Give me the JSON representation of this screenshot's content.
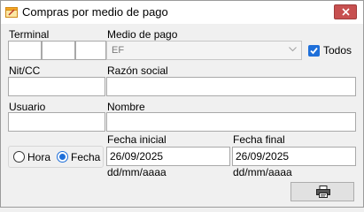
{
  "window": {
    "title": "Compras por medio de pago"
  },
  "labels": {
    "terminal": "Terminal",
    "medio_pago": "Medio de pago",
    "nit_cc": "Nit/CC",
    "razon_social": "Razón social",
    "usuario": "Usuario",
    "nombre": "Nombre",
    "fecha_inicial": "Fecha inicial",
    "fecha_final": "Fecha final",
    "date_format_inicial": "dd/mm/aaaa",
    "date_format_final": "dd/mm/aaaa"
  },
  "fields": {
    "terminal_1": "",
    "terminal_2": "",
    "terminal_3": "",
    "medio_pago_selected": "EF",
    "nit_cc": "",
    "razon_social": "",
    "usuario": "",
    "nombre": "",
    "fecha_inicial": "26/09/2025",
    "fecha_final": "26/09/2025"
  },
  "todos": {
    "label": "Todos",
    "checked": true
  },
  "time_mode": {
    "options": [
      "Hora",
      "Fecha"
    ],
    "selected": "Fecha"
  },
  "icons": {
    "app": "app-form-icon",
    "close": "close-icon",
    "print": "printer-icon"
  },
  "colors": {
    "accent": "#1e6fd9",
    "close": "#c75050"
  }
}
